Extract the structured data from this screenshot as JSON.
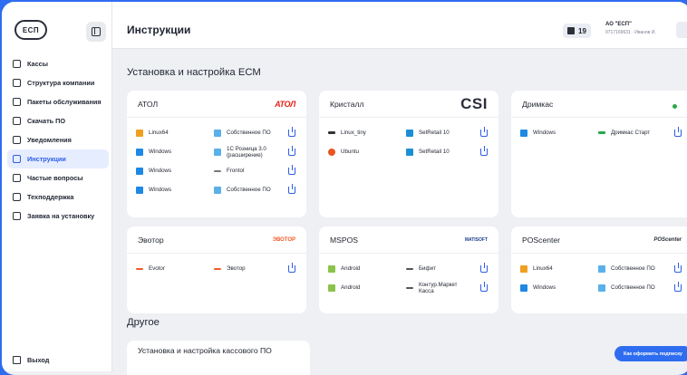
{
  "app": {
    "logo": "ЕСП",
    "page_title": "Инструкции"
  },
  "sidebar": {
    "items": [
      {
        "label": "Кассы"
      },
      {
        "label": "Структура компании"
      },
      {
        "label": "Пакеты обслуживания"
      },
      {
        "label": "Скачать ПО"
      },
      {
        "label": "Уведомления"
      },
      {
        "label": "Инструкции",
        "active": true
      },
      {
        "label": "Частые вопросы"
      },
      {
        "label": "Техподдержка"
      },
      {
        "label": "Заявка на установку"
      }
    ],
    "logout": "Выход"
  },
  "header": {
    "count": "19",
    "company": "АО \"ЕСП\"",
    "company_sub": "9717169631 · Иванов И."
  },
  "sections": {
    "ecm_title": "Установка и настройка ЕСМ",
    "other_title": "Другое",
    "other_card_title": "Установка и настройка кассового ПО"
  },
  "cards": [
    {
      "title": "АТОЛ",
      "brand": "АТОЛ",
      "rows": [
        {
          "os": "Linux64",
          "os_icon": "linux-icon",
          "sw": "Собственное ПО",
          "sw_icon": "cloud-icon"
        },
        {
          "os": "Windows",
          "os_icon": "windows-icon",
          "sw": "1С Розница 3.0 (расширение)",
          "sw_icon": "cloud-icon"
        },
        {
          "os": "Windows",
          "os_icon": "windows-icon",
          "sw": "Frontol",
          "sw_icon": "frontol-icon"
        },
        {
          "os": "Windows",
          "os_icon": "windows-icon",
          "sw": "Собственное ПО",
          "sw_icon": "cloud-icon"
        }
      ]
    },
    {
      "title": "Кристалл",
      "brand": "CSI",
      "rows": [
        {
          "os": "Linux_tiny",
          "os_icon": "linux-icon",
          "sw": "SetRetail 10",
          "sw_icon": "setretail-icon"
        },
        {
          "os": "Ubuntu",
          "os_icon": "ubuntu-icon",
          "sw": "SetRetail 10",
          "sw_icon": "setretail-icon"
        }
      ]
    },
    {
      "title": "Дримкас",
      "brand": "",
      "rows": [
        {
          "os": "Windows",
          "os_icon": "windows-icon",
          "sw": "Дримкас Старт",
          "sw_icon": "dreamkas-icon"
        }
      ]
    },
    {
      "title": "Эвотор",
      "brand": "ЭВОТОР",
      "rows": [
        {
          "os": "Evotor",
          "os_icon": "evotor-icon",
          "sw": "Эвотор",
          "sw_icon": "evotor-icon"
        }
      ]
    },
    {
      "title": "MSPOS",
      "brand": "MATISOFT",
      "rows": [
        {
          "os": "Android",
          "os_icon": "android-icon",
          "sw": "Бифит",
          "sw_icon": "bifit-icon"
        },
        {
          "os": "Android",
          "os_icon": "android-icon",
          "sw": "Контур.Маркет Касса",
          "sw_icon": "kontur-icon"
        }
      ]
    },
    {
      "title": "POScenter",
      "brand": "POScenter",
      "rows": [
        {
          "os": "Linux64",
          "os_icon": "linux-icon",
          "sw": "Собственное ПО",
          "sw_icon": "cloud-icon"
        },
        {
          "os": "Windows",
          "os_icon": "windows-icon",
          "sw": "Собственное ПО",
          "sw_icon": "cloud-icon"
        }
      ]
    }
  ],
  "cta": "Как оформить подписку",
  "colors": {
    "accent": "#2f6df0",
    "active_bg": "#e6edff",
    "atol": "#e8231a",
    "evotor": "#f15a24"
  }
}
